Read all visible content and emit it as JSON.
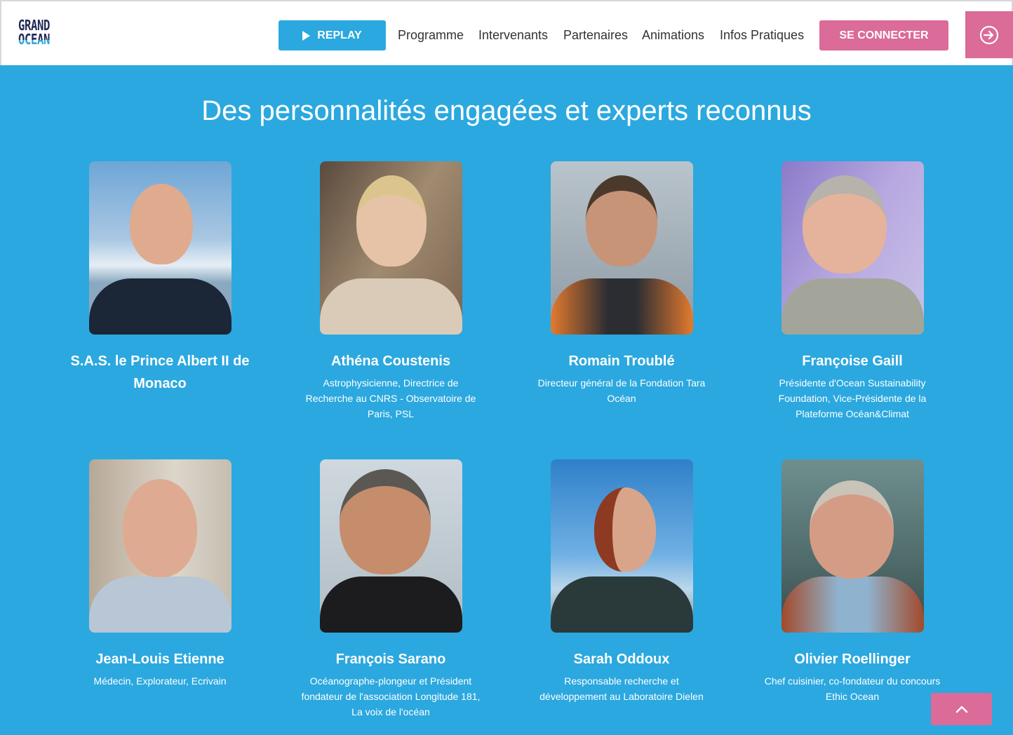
{
  "header": {
    "logo": {
      "line1": "GRAND",
      "line2": "OCEAN"
    },
    "replay_label": "REPLAY",
    "nav": [
      {
        "label": "Programme"
      },
      {
        "label": "Intervenants"
      },
      {
        "label": "Partenaires"
      },
      {
        "label": "Animations"
      },
      {
        "label": "Infos Pratiques"
      }
    ],
    "connect_label": "SE CONNECTER"
  },
  "section": {
    "title": "Des personnalités engagées et experts reconnus"
  },
  "speakers": [
    {
      "name": "S.A.S. le Prince Albert II de Monaco",
      "role": ""
    },
    {
      "name": "Athéna Coustenis",
      "role": "Astrophysicienne, Directrice de Recherche au CNRS - Observatoire de Paris, PSL"
    },
    {
      "name": "Romain Troublé",
      "role": "Directeur général de la Fondation Tara Océan"
    },
    {
      "name": "Françoise Gaill",
      "role": "Présidente d'Ocean Sustainability Foundation, Vice-Présidente de la Plateforme Océan&Climat"
    },
    {
      "name": "Jean-Louis Etienne",
      "role": "Médecin, Explorateur, Ecrivain"
    },
    {
      "name": "François Sarano",
      "role": "Océanographe-plongeur et Président fondateur de l'association Longitude 181, La voix de l'océan"
    },
    {
      "name": "Sarah Oddoux",
      "role": "Responsable recherche et développement au Laboratoire Dielen"
    },
    {
      "name": "Olivier Roellinger",
      "role": "Chef cuisinier, co-fondateur du concours Ethic Ocean"
    }
  ],
  "colors": {
    "background": "#2ba8df",
    "accent_pink": "#db6b98",
    "navy": "#1f2a56"
  },
  "icons": {
    "replay": "play-icon",
    "login": "login-arrow-icon",
    "back_to_top": "chevron-up-icon"
  }
}
